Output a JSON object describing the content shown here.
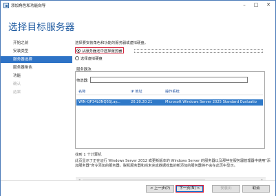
{
  "window": {
    "title": "添加角色和功能向导"
  },
  "header": {
    "page_title": "选择目标服务器",
    "dest_label": "目标服务器",
    "dest_value": "WIN-QP34L0NQ5SJ"
  },
  "nav": {
    "items": [
      {
        "label": "开始之前",
        "state": "normal"
      },
      {
        "label": "安装类型",
        "state": "normal"
      },
      {
        "label": "服务器选择",
        "state": "active"
      },
      {
        "label": "服务器角色",
        "state": "normal"
      },
      {
        "label": "功能",
        "state": "normal"
      },
      {
        "label": "确认",
        "state": "disabled"
      },
      {
        "label": "结果",
        "state": "disabled"
      }
    ]
  },
  "main": {
    "instruction": "选择要安装角色和功能的服务器或虚拟硬盘。",
    "radio_pool": "从服务器池中选择服务器",
    "radio_vhd": "选择虚拟硬盘",
    "pool_label": "服务器池",
    "filter_label": "筛选器:",
    "filter_value": "",
    "columns": {
      "name": "名称",
      "ip": "IP 地址",
      "os": "操作系统"
    },
    "rows": [
      {
        "name": "WIN-QP34L0NQ5SJ.ay...",
        "ip": "20.20.20.21",
        "os": "Microsoft Windows Server 2025 Standard Evaluatio"
      }
    ],
    "found": "找到 1 个计算机",
    "note": "此页显示了正在运行 Windows Server 2012 或更新版本的 Windows Server 的服务器以及那些在服务器管理器中使用\"添加服务器\"命令添加的服务器。脱机服务器和尚未完成数据收集的新添加的服务器将不会在此页中显示。"
  },
  "footer": {
    "prev": "< 上一步(P)",
    "next": "下一页(N) >",
    "install": "安装(I)",
    "cancel": "取消"
  },
  "colors": {
    "accent": "#2e73c6",
    "title_blue": "#1e5aa0",
    "highlight_red": "#d6243c"
  }
}
